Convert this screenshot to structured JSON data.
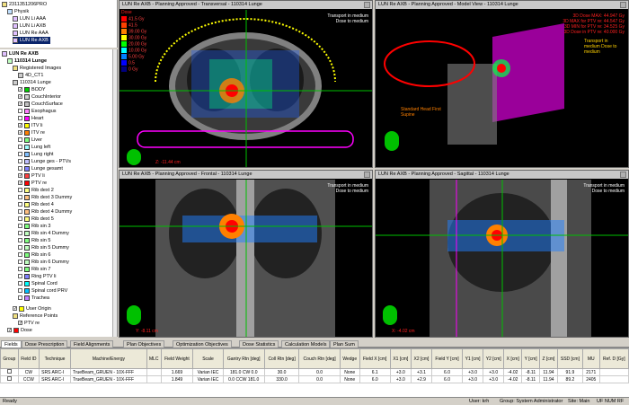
{
  "tree_top": {
    "root": "2311351206PRO",
    "patient": "Physik",
    "plans": [
      "LUN Li AAA",
      "LUN Li AXB",
      "LUN Re AAA",
      "LUN Re AXB"
    ]
  },
  "tree": {
    "plan": "LUN Re AXB",
    "course": "110314 Lunge",
    "registered": "Registered Images",
    "ct": "4D_CT1",
    "image": "110314 Lunge",
    "structures": [
      {
        "name": "BODY",
        "color": "#00d000",
        "checked": true
      },
      {
        "name": "CouchInterior",
        "color": "#d0d0d0",
        "checked": true
      },
      {
        "name": "CouchSurface",
        "color": "#c0c0c0",
        "checked": true
      },
      {
        "name": "Esophagus",
        "color": "#ff80ff",
        "checked": false
      },
      {
        "name": "Heart",
        "color": "#ff00ff",
        "checked": false
      },
      {
        "name": "ITV li",
        "color": "#ffff00",
        "checked": true
      },
      {
        "name": "ITV re",
        "color": "#ff8000",
        "checked": true
      },
      {
        "name": "Liver",
        "color": "#80ff80",
        "checked": false
      },
      {
        "name": "Lung left",
        "color": "#a0ffff",
        "checked": false
      },
      {
        "name": "Lung right",
        "color": "#80c0ff",
        "checked": false
      },
      {
        "name": "Lunge ges - PTVs",
        "color": "#c0c0ff",
        "checked": false
      },
      {
        "name": "Lunge gesamt",
        "color": "#8080ff",
        "checked": false
      },
      {
        "name": "PTV li",
        "color": "#ff4040",
        "checked": true
      },
      {
        "name": "PTV re",
        "color": "#ff0000",
        "checked": true
      },
      {
        "name": "Rib dext 2",
        "color": "#ffff80",
        "checked": false
      },
      {
        "name": "Rib dext 3 Dummy",
        "color": "#ffc080",
        "checked": false
      },
      {
        "name": "Rib dext 4",
        "color": "#ffff80",
        "checked": false
      },
      {
        "name": "Rib dext 4 Dummy",
        "color": "#ffc080",
        "checked": false
      },
      {
        "name": "Rib dext 5",
        "color": "#ffff80",
        "checked": false
      },
      {
        "name": "Rib sin 3",
        "color": "#80ff80",
        "checked": false
      },
      {
        "name": "Rib sin 4 Dummy",
        "color": "#c0ffc0",
        "checked": false
      },
      {
        "name": "Rib sin 5",
        "color": "#80ff80",
        "checked": false
      },
      {
        "name": "Rib sin 5 Dummy",
        "color": "#c0ffc0",
        "checked": false
      },
      {
        "name": "Rib sin 6",
        "color": "#80ff80",
        "checked": false
      },
      {
        "name": "Rib sin 6 Dummy",
        "color": "#c0ffc0",
        "checked": false
      },
      {
        "name": "Rib sin 7",
        "color": "#80ff80",
        "checked": false
      },
      {
        "name": "Ring PTV li",
        "color": "#8080ff",
        "checked": false
      },
      {
        "name": "Spinal Cord",
        "color": "#00ffff",
        "checked": false
      },
      {
        "name": "Spinal cord PRV",
        "color": "#00c0ff",
        "checked": false
      },
      {
        "name": "Trachea",
        "color": "#c080ff",
        "checked": false
      }
    ],
    "user_origin": "User Origin",
    "ref_points": "Reference Points",
    "ptv_re": "PTV re",
    "dose": "Dose"
  },
  "viewports": {
    "transversal": {
      "title": "LUN Re AXB - Planning Approved - Transversal - 110314 Lunge",
      "note1": "Transport in medium",
      "note2": "Dose to medium",
      "zpos": "Z: -11.44 cm",
      "legend_title": "Dose",
      "legend": [
        "41.5 Gy",
        "41.5",
        "39.00 Gy",
        "30.00 Gy",
        "20.00 Gy",
        "10.00 Gy",
        "5.00 Gy",
        "0.5",
        "0 Gy"
      ],
      "legend_colors": [
        "#ff0000",
        "#ff4000",
        "#ff8000",
        "#ffff00",
        "#00ff00",
        "#00ffff",
        "#0080ff",
        "#0000ff",
        "#000080"
      ]
    },
    "model": {
      "title": "LUN Re AXB - Planning Approved - Model View - 110314 Lunge",
      "stats": [
        "3D Dose MAX: 44.947 Gy",
        "3D MAX for PTV re: 44.547 Gy",
        "3D MIN for PTV re: 34.525 Gy",
        "3D Dose in PTV re: 40.000 Gy"
      ],
      "note": "Transport in medium Dose to medium",
      "couch": "Standard Head First Supine"
    },
    "frontal": {
      "title": "LUN Re AXB - Planning Approved - Frontal - 110314 Lunge",
      "note1": "Transport in medium",
      "note2": "Dose to medium",
      "pos": "Y: -8.11 cm"
    },
    "sagittal": {
      "title": "LUN Re AXB - Planning Approved - Sagittal - 110314 Lunge",
      "note1": "Transport in medium",
      "note2": "Dose to medium",
      "pos": "X: -4.02 cm"
    }
  },
  "tabs": [
    "Fields",
    "Dose Prescription",
    "Field Alignments",
    "Plan Objectives",
    "Optimization Objectives",
    "Dose Statistics",
    "Calculation Models",
    "Plan Sum"
  ],
  "table": {
    "headers": [
      "Group",
      "Field ID",
      "Technique",
      "Machine/Energy",
      "MLC",
      "Field Weight",
      "Scale",
      "Gantry Rtn [deg]",
      "Coll Rtn [deg]",
      "Couch Rtn [deg]",
      "Wedge",
      "Field X [cm]",
      "X1 [cm]",
      "X2 [cm]",
      "Field Y [cm]",
      "Y1 [cm]",
      "Y2 [cm]",
      "X [cm]",
      "Y [cm]",
      "Z [cm]",
      "SSD [cm]",
      "MU",
      "Ref. D [Gy]"
    ],
    "rows": [
      [
        "",
        "CW",
        "SRS ARC-I",
        "TrueBeam_GRUEN - 10X-FFF",
        "",
        "1.669",
        "Varian IEC",
        "181.0 CW 0.0",
        "30.0",
        "0.0",
        "None",
        "6.1",
        "+3.0",
        "+3.1",
        "6.0",
        "+3.0",
        "+3.0",
        "-4.02",
        "-8.11",
        "11.94",
        "91.9",
        "2171",
        ""
      ],
      [
        "",
        "CCW",
        "SRS ARC-I",
        "TrueBeam_GRUEN - 10X-FFF",
        "",
        "1.849",
        "Varian IEC",
        "0.0 CCW 181.0",
        "330.0",
        "0.0",
        "None",
        "6.0",
        "+3.0",
        "+2.9",
        "6.0",
        "+3.0",
        "+3.0",
        "-4.02",
        "-8.11",
        "11.94",
        "89.2",
        "2405",
        ""
      ]
    ]
  },
  "status": {
    "left": "Ready",
    "user": "User: krh",
    "group": "Group: System Administrator",
    "site": "Site: Main",
    "indicators": "UF NUM RF"
  }
}
